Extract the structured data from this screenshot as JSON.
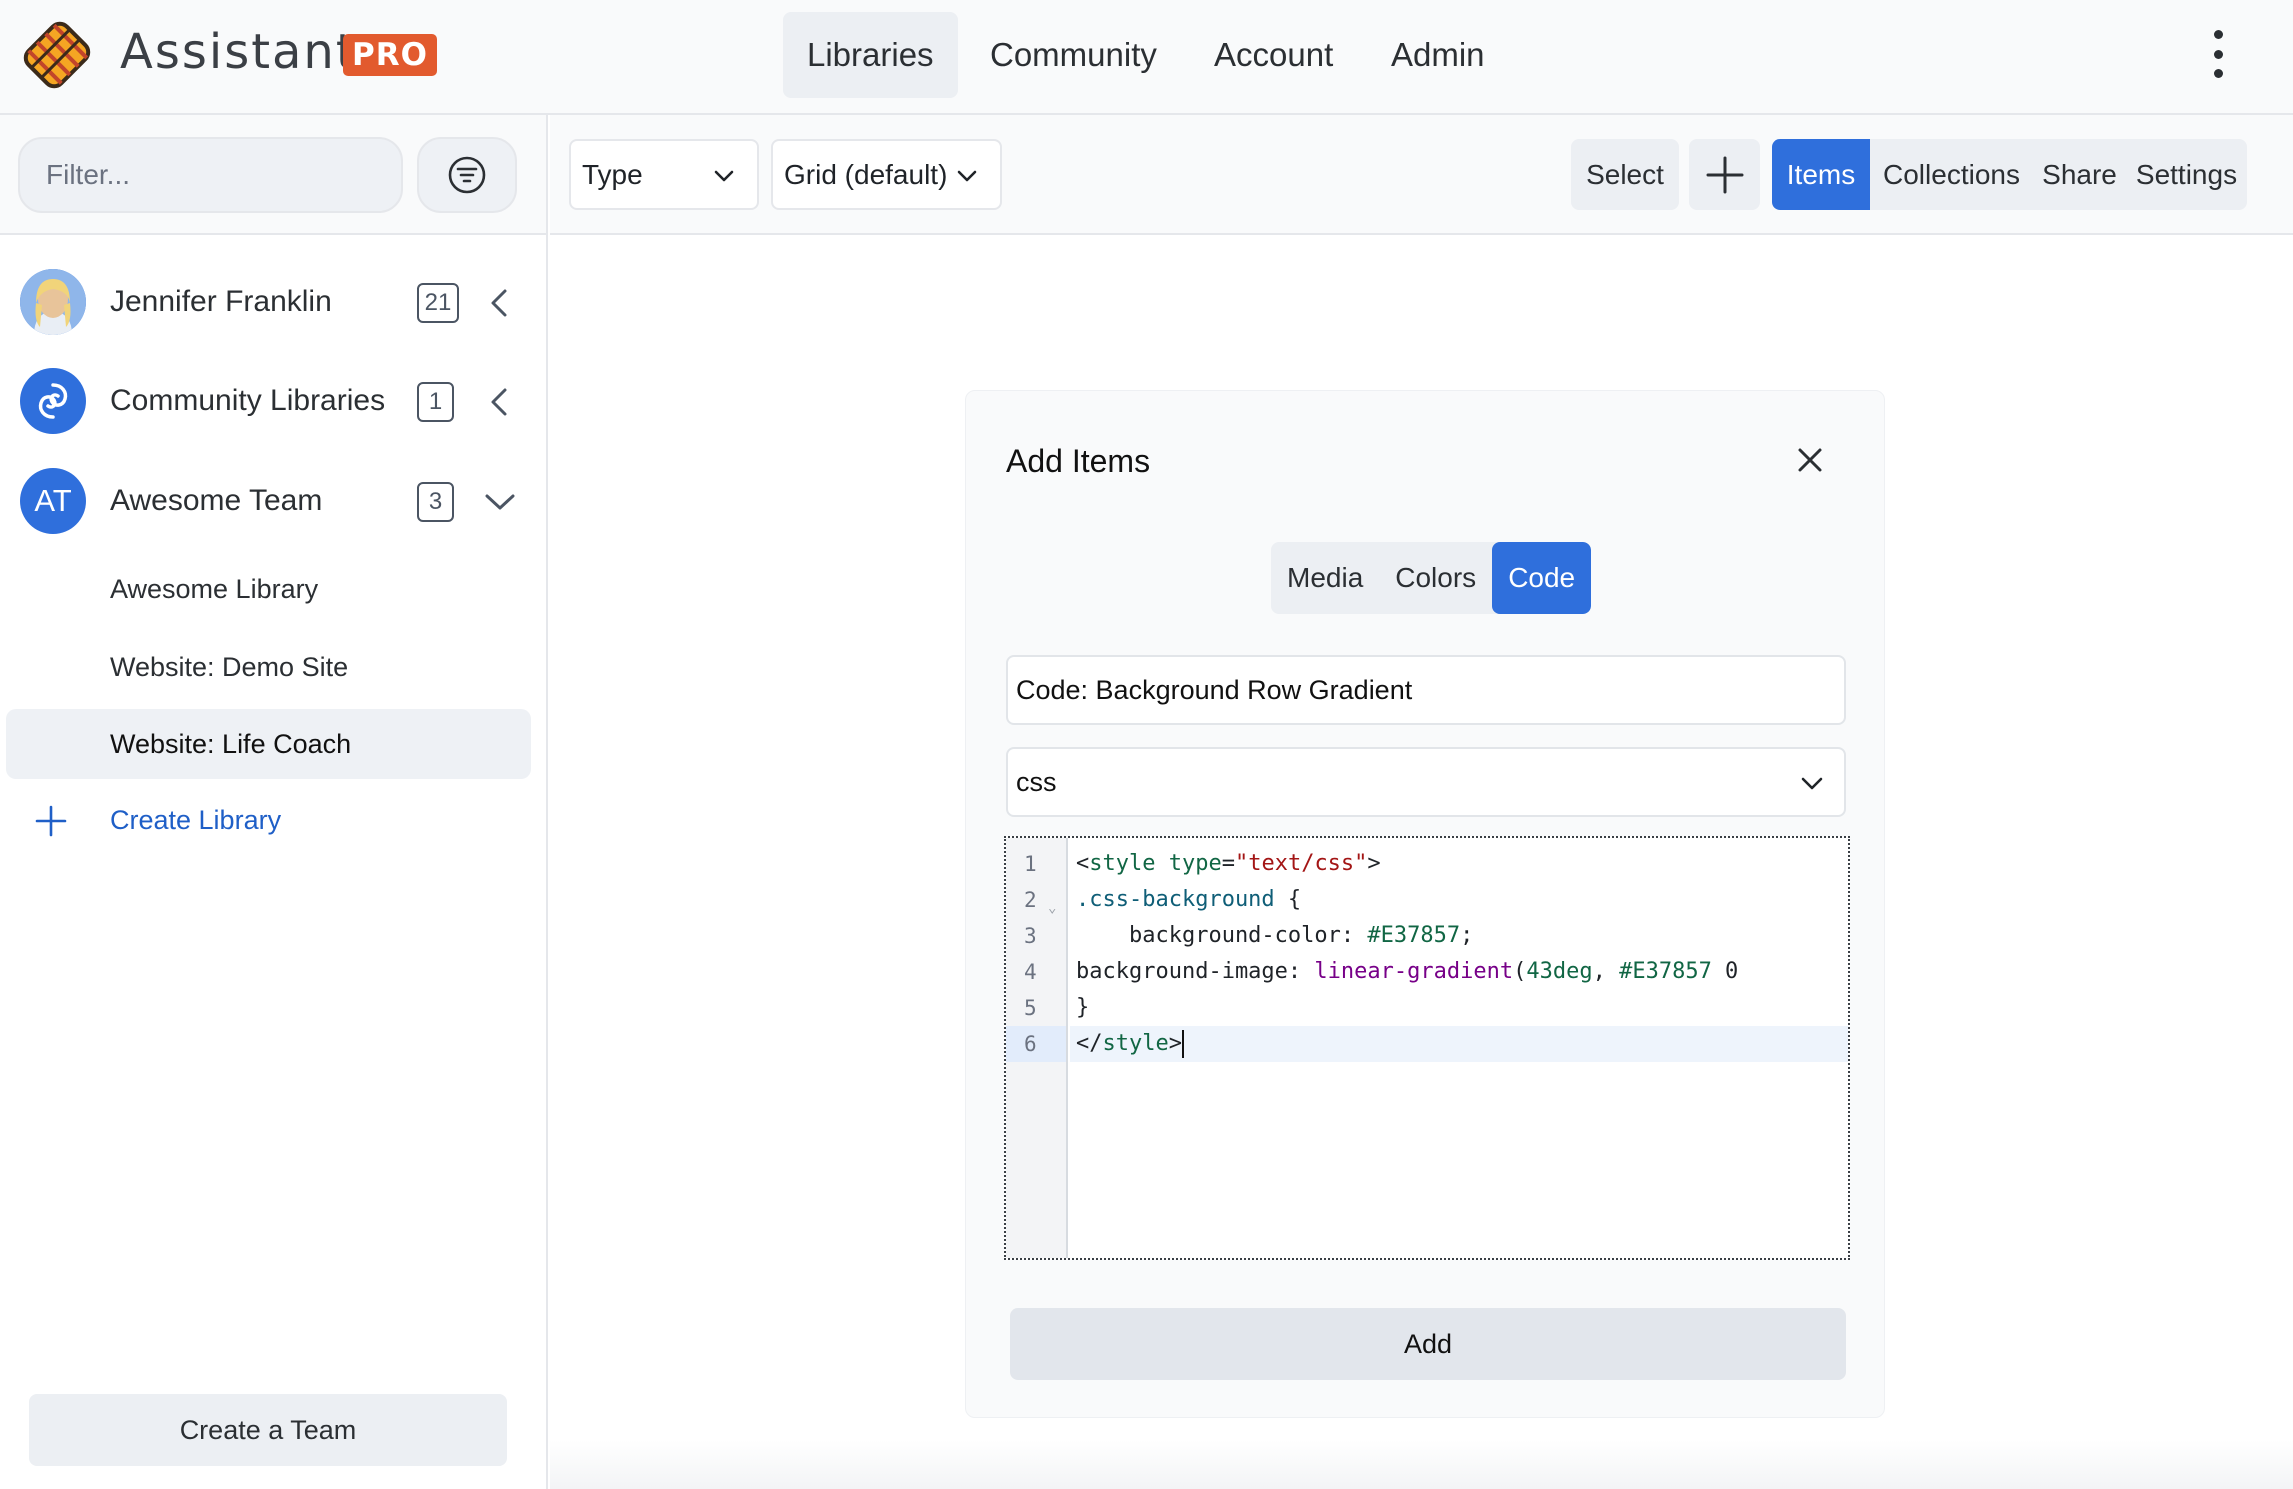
{
  "app": {
    "name": "Assistant",
    "badge": "PRO",
    "brand_color": "#e25a2e",
    "accent_color": "#2f6fdc"
  },
  "nav": {
    "items": [
      {
        "label": "Libraries",
        "active": true
      },
      {
        "label": "Community",
        "active": false
      },
      {
        "label": "Account",
        "active": false
      },
      {
        "label": "Admin",
        "active": false
      }
    ],
    "menu_icon": "kebab-vertical-icon"
  },
  "sidebar": {
    "filter_placeholder": "Filter...",
    "filter_icon": "filter-lines-icon",
    "libraries": [
      {
        "label": "Jennifer Franklin",
        "count": "21",
        "avatar": "photo",
        "expanded": false
      },
      {
        "label": "Community Libraries",
        "count": "1",
        "avatar": "community-logo-icon",
        "expanded": false
      },
      {
        "label": "Awesome Team",
        "count": "3",
        "avatar_initials": "AT",
        "expanded": true
      }
    ],
    "sub_items": [
      {
        "label": "Awesome Library",
        "active": false
      },
      {
        "label": "Website: Demo Site",
        "active": false
      },
      {
        "label": "Website: Life Coach",
        "active": true
      }
    ],
    "create_library": "Create Library",
    "create_team": "Create a Team"
  },
  "toolbar": {
    "type_select": "Type",
    "view_select": "Grid (default)",
    "select_label": "Select",
    "add_icon": "plus-icon",
    "tabs": [
      {
        "label": "Items",
        "active": true
      },
      {
        "label": "Collections",
        "active": false
      },
      {
        "label": "Share",
        "active": false
      },
      {
        "label": "Settings",
        "active": false
      }
    ]
  },
  "dialog": {
    "title": "Add Items",
    "close_icon": "close-icon",
    "tabs": [
      {
        "label": "Media",
        "active": false
      },
      {
        "label": "Colors",
        "active": false
      },
      {
        "label": "Code",
        "active": true
      }
    ],
    "title_value": "Code: Background Row Gradient",
    "language": "css",
    "code_lines": [
      "<style type=\"text/css\">",
      ".css-background {",
      "    background-color: #E37857;",
      "background-image: linear-gradient(43deg, #E37857 0",
      "}",
      "</style>"
    ],
    "line_numbers": [
      "1",
      "2",
      "3",
      "4",
      "5",
      "6"
    ],
    "active_line": 6,
    "add_label": "Add"
  }
}
